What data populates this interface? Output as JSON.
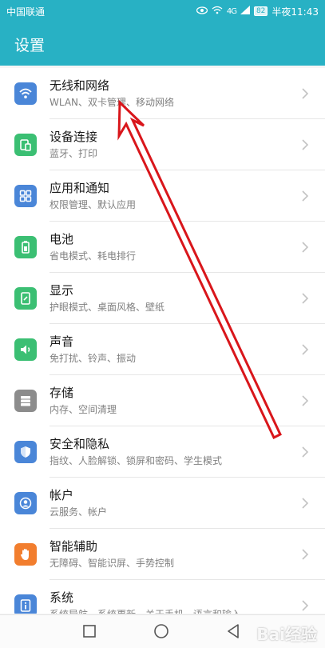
{
  "status_bar": {
    "carrier": "中国联通",
    "signal": "4G",
    "battery": "82",
    "time": "半夜11:43"
  },
  "header": {
    "title": "设置"
  },
  "colors": {
    "accent": "#28b1c4",
    "wireless": "#4a86d8",
    "devices": "#3bbf73",
    "apps": "#4a86d8",
    "battery": "#3bbf73",
    "display": "#3bbf73",
    "sound": "#3bbf73",
    "storage": "#8c8c8c",
    "security": "#4a86d8",
    "accounts": "#4a86d8",
    "assist": "#f27e2e",
    "system": "#4a86d8",
    "annotation_arrow": "#d9161b"
  },
  "settings": [
    {
      "title": "无线和网络",
      "subtitle": "WLAN、双卡管理、移动网络",
      "icon": "wifi-icon"
    },
    {
      "title": "设备连接",
      "subtitle": "蓝牙、打印",
      "icon": "device-connection-icon"
    },
    {
      "title": "应用和通知",
      "subtitle": "权限管理、默认应用",
      "icon": "apps-grid-icon"
    },
    {
      "title": "电池",
      "subtitle": "省电模式、耗电排行",
      "icon": "battery-icon"
    },
    {
      "title": "显示",
      "subtitle": "护眼模式、桌面风格、壁纸",
      "icon": "display-icon"
    },
    {
      "title": "声音",
      "subtitle": "免打扰、铃声、振动",
      "icon": "speaker-icon"
    },
    {
      "title": "存储",
      "subtitle": "内存、空间清理",
      "icon": "storage-icon"
    },
    {
      "title": "安全和隐私",
      "subtitle": "指纹、人脸解锁、锁屏和密码、学生模式",
      "icon": "shield-icon"
    },
    {
      "title": "帐户",
      "subtitle": "云服务、帐户",
      "icon": "account-icon"
    },
    {
      "title": "智能辅助",
      "subtitle": "无障碍、智能识屏、手势控制",
      "icon": "hand-icon"
    },
    {
      "title": "系统",
      "subtitle": "系统导航、系统更新、关于手机、语言和输入",
      "icon": "info-icon"
    }
  ],
  "watermark": "Bai经验"
}
